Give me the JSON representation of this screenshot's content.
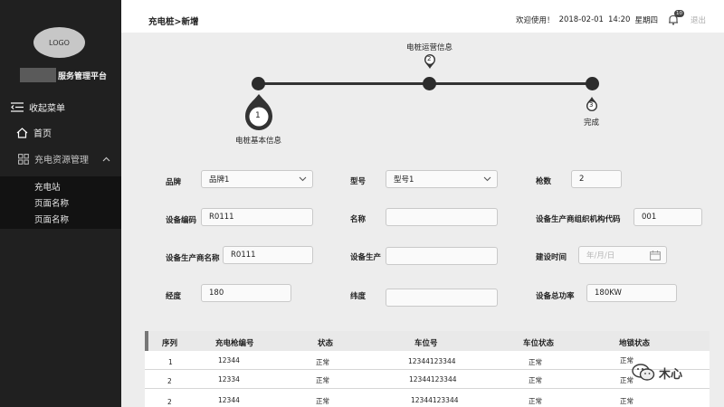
{
  "sidebar": {
    "logo": "LOGO",
    "platform_name": "服务管理平台",
    "collapse_label": "收起菜单",
    "home_label": "首页",
    "group_label": "充电资源管理",
    "sub_items": [
      "充电站",
      "页面名称",
      "页面名称"
    ]
  },
  "header": {
    "title": "充电桩>新增",
    "welcome": "欢迎使用！",
    "date": "2018-02-01",
    "time": "14:20",
    "weekday": "星期四",
    "badge": "10",
    "logout": "退出"
  },
  "steps": [
    {
      "number": "1",
      "label": "电桩基本信息"
    },
    {
      "number": "2",
      "label": "电桩运营信息"
    },
    {
      "number": "3",
      "label": "完成"
    }
  ],
  "form": {
    "brand": {
      "label": "品牌",
      "value": "品牌1"
    },
    "model": {
      "label": "型号",
      "value": "型号1"
    },
    "gun_count": {
      "label": "枪数",
      "value": "2"
    },
    "device_code": {
      "label": "设备编码",
      "value": "R0111"
    },
    "name": {
      "label": "名称",
      "value": ""
    },
    "org_code": {
      "label": "设备生产商组织机构代码",
      "value": "001"
    },
    "maker_name": {
      "label": "设备生产商名称",
      "value": "R0111"
    },
    "production": {
      "label": "设备生产",
      "value": ""
    },
    "build_time": {
      "label": "建设时间",
      "placeholder": "年/月/日"
    },
    "longitude": {
      "label": "经度",
      "value": "180"
    },
    "latitude": {
      "label": "纬度",
      "value": ""
    },
    "total_power": {
      "label": "设备总功率",
      "value": "180KW"
    }
  },
  "table": {
    "columns": [
      "序列",
      "充电枪编号",
      "状态",
      "车位号",
      "车位状态",
      "地锁状态"
    ],
    "rows": [
      [
        "1",
        "12344",
        "正常",
        "12344123344",
        "正常",
        "正常"
      ],
      [
        "2",
        "12334",
        "正常",
        "12344123344",
        "正常",
        "正常"
      ],
      [
        "2",
        "12344",
        "正常",
        "12344123344",
        "正常",
        "正常"
      ]
    ]
  },
  "watermark": "木心"
}
